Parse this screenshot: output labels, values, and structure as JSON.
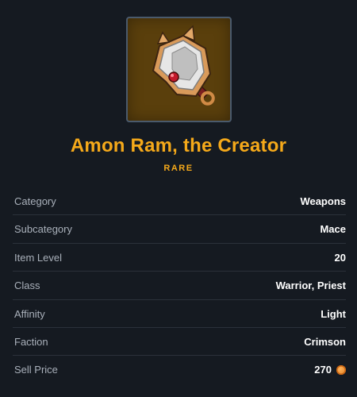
{
  "item": {
    "name": "Amon Ram, the Creator",
    "rarity": "RARE",
    "icon": "mace-icon",
    "frame_color": "#5a3f0c",
    "accent_color": "#f5a91a"
  },
  "stats": [
    {
      "label": "Category",
      "value": "Weapons"
    },
    {
      "label": "Subcategory",
      "value": "Mace"
    },
    {
      "label": "Item Level",
      "value": "20"
    },
    {
      "label": "Class",
      "value": "Warrior, Priest"
    },
    {
      "label": "Affinity",
      "value": "Light"
    },
    {
      "label": "Faction",
      "value": "Crimson"
    },
    {
      "label": "Sell Price",
      "value": "270",
      "icon": "coin-icon"
    }
  ]
}
